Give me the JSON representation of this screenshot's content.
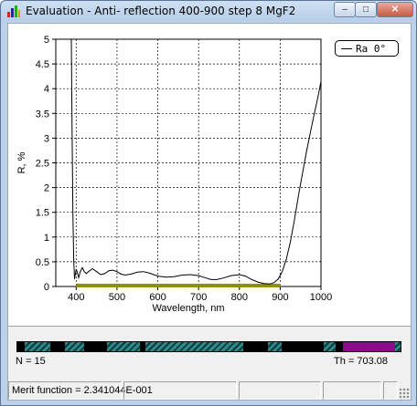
{
  "window": {
    "title": "Evaluation - Anti- reflection 400-900 step 8 MgF2",
    "min_label": "–",
    "max_label": "□",
    "close_label": "✕"
  },
  "legend": {
    "label": "Ra  0°"
  },
  "chart_data": {
    "type": "line",
    "xlabel": "Wavelength, nm",
    "ylabel": "R, %",
    "xlim": [
      350,
      1000
    ],
    "ylim": [
      0,
      5
    ],
    "x_ticks": [
      400,
      500,
      600,
      700,
      800,
      900,
      1000
    ],
    "y_ticks": [
      0,
      0.5,
      1,
      1.5,
      2,
      2.5,
      3,
      3.5,
      4,
      4.5,
      5
    ],
    "grid": true,
    "legend_position": "top-right",
    "target_band": [
      400,
      900
    ],
    "series": [
      {
        "name": "Ra  0°",
        "x": [
          388,
          390,
          392,
          394,
          396,
          398,
          400,
          403,
          406,
          410,
          415,
          420,
          425,
          430,
          440,
          450,
          460,
          470,
          480,
          490,
          500,
          510,
          520,
          535,
          550,
          565,
          580,
          600,
          620,
          640,
          660,
          680,
          700,
          715,
          730,
          745,
          760,
          780,
          800,
          815,
          830,
          845,
          860,
          875,
          885,
          895,
          905,
          915,
          925,
          935,
          945,
          955,
          965,
          975,
          985,
          993,
          1000
        ],
        "y": [
          5.0,
          3.2,
          1.5,
          0.55,
          0.15,
          0.25,
          0.35,
          0.28,
          0.18,
          0.3,
          0.38,
          0.3,
          0.26,
          0.3,
          0.36,
          0.3,
          0.24,
          0.26,
          0.32,
          0.33,
          0.3,
          0.25,
          0.23,
          0.25,
          0.29,
          0.3,
          0.27,
          0.21,
          0.19,
          0.2,
          0.23,
          0.24,
          0.22,
          0.18,
          0.14,
          0.14,
          0.17,
          0.22,
          0.24,
          0.21,
          0.14,
          0.09,
          0.06,
          0.05,
          0.08,
          0.15,
          0.3,
          0.55,
          0.9,
          1.35,
          1.85,
          2.3,
          2.75,
          3.15,
          3.55,
          3.85,
          4.15
        ]
      }
    ]
  },
  "layers": {
    "segments": [
      {
        "type": "hatch",
        "start": 0.02,
        "end": 0.085
      },
      {
        "type": "hatch",
        "start": 0.125,
        "end": 0.175
      },
      {
        "type": "hatch",
        "start": 0.235,
        "end": 0.32
      },
      {
        "type": "hatch",
        "start": 0.335,
        "end": 0.59
      },
      {
        "type": "hatch",
        "start": 0.655,
        "end": 0.69
      },
      {
        "type": "hatch",
        "start": 0.8,
        "end": 0.83
      },
      {
        "type": "purple",
        "start": 0.85,
        "end": 0.985
      },
      {
        "type": "hatch",
        "start": 0.985,
        "end": 1.0
      }
    ],
    "n_label": "N = 15",
    "th_label": "Th = 703.08"
  },
  "status": {
    "merit": "Merit function =  2.341044E-001",
    "cells": [
      "",
      "",
      "",
      ""
    ]
  },
  "colors": {
    "curve": "#000000",
    "band": "#8f8f10",
    "grid": "#000000",
    "hatch": "#2e8a8a",
    "purple": "#8a0c8a"
  }
}
